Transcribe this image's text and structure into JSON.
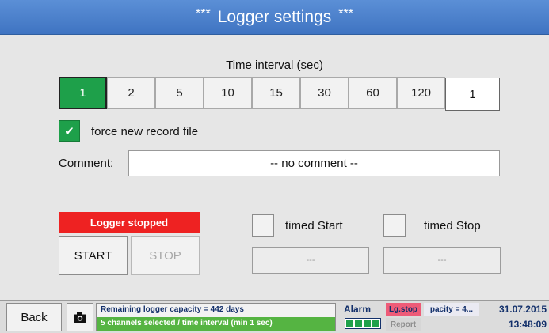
{
  "title": "Logger settings",
  "title_decoration": "***",
  "interval": {
    "label": "Time interval (sec)",
    "options": [
      "1",
      "2",
      "5",
      "10",
      "15",
      "30",
      "60",
      "120"
    ],
    "selected": "1",
    "custom_value": "1"
  },
  "force_new_file": {
    "label": "force new record file",
    "checked": true,
    "check_glyph": "✔"
  },
  "comment": {
    "label": "Comment:",
    "value": "-- no comment --"
  },
  "logger": {
    "status": "Logger stopped",
    "start_label": "START",
    "stop_label": "STOP",
    "timed_start_label": "timed Start",
    "timed_stop_label": "timed Stop",
    "timed_start_value": "---",
    "timed_stop_value": "---"
  },
  "statusbar": {
    "back_label": "Back",
    "camera_icon": "camera-icon",
    "capacity_text": "Remaining logger capacity = 442 days",
    "channels_text": "5 channels selected / time interval (min 1 sec)",
    "alarm_label": "Alarm",
    "lgstop_label": "Lg.stop",
    "report_label": "Report",
    "capacity_ticker": "pacity = 4...",
    "date": "31.07.2015",
    "time": "13:48:09"
  },
  "colors": {
    "accent_green": "#1ea04a",
    "status_red": "#ee2222",
    "title_blue": "#4a80cc"
  }
}
